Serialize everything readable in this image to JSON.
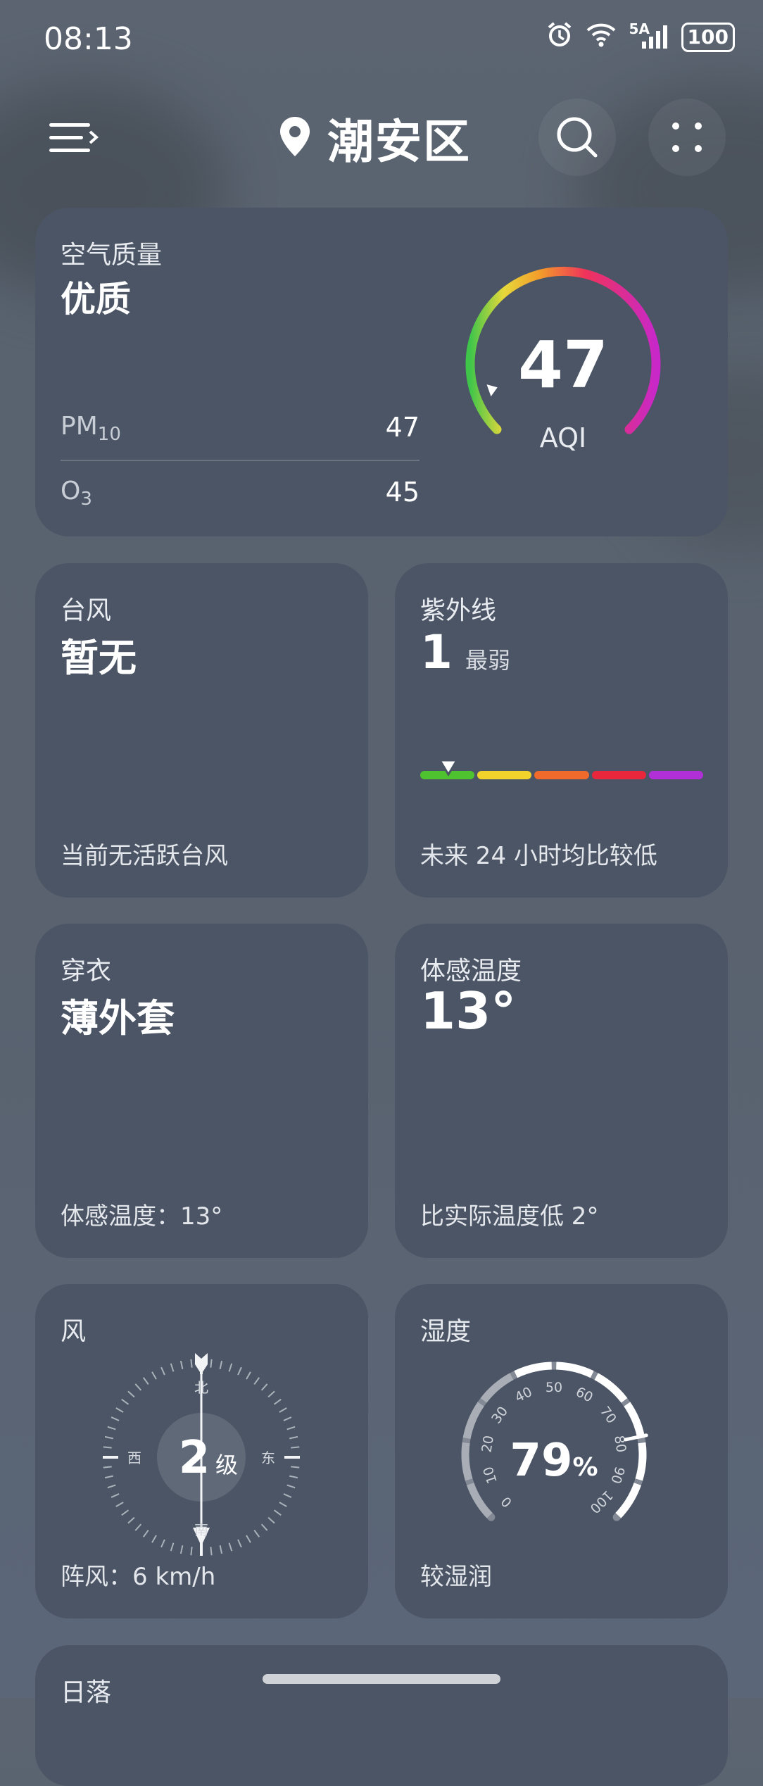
{
  "status": {
    "time": "08:13",
    "network": "5A",
    "battery": "100"
  },
  "header": {
    "location": "潮安区"
  },
  "air": {
    "title": "空气质量",
    "quality": "优质",
    "rows": [
      {
        "label_main": "PM",
        "label_sub": "10",
        "value": "47"
      },
      {
        "label_main": "O",
        "label_sub": "3",
        "value": "45"
      }
    ],
    "aqi": "47",
    "aqi_label": "AQI",
    "aqi_fraction": 0.094
  },
  "typhoon": {
    "title": "台风",
    "value": "暂无",
    "note": "当前无活跃台风"
  },
  "uv": {
    "title": "紫外线",
    "value": "1",
    "level": "最弱",
    "note": "未来 24 小时均比较低",
    "segment_colors": [
      "#4ec22f",
      "#f2d32b",
      "#f06a2b",
      "#e8263c",
      "#b12fd6"
    ],
    "marker_fraction": 0.1
  },
  "clothing": {
    "title": "穿衣",
    "value": "薄外套",
    "note": "体感温度：13°"
  },
  "feels": {
    "title": "体感温度",
    "value": "13°",
    "note": "比实际温度低 2°"
  },
  "wind": {
    "title": "风",
    "level": "2",
    "unit": "级",
    "north": "北",
    "south": "南",
    "east": "东",
    "west": "西",
    "note": "阵风：6 km/h"
  },
  "humidity": {
    "title": "湿度",
    "value": "79",
    "unit": "%",
    "note": "较湿润",
    "ticks": [
      "0",
      "10",
      "20",
      "30",
      "40",
      "50",
      "60",
      "70",
      "80",
      "90",
      "100"
    ]
  },
  "sunset": {
    "title": "日落"
  }
}
